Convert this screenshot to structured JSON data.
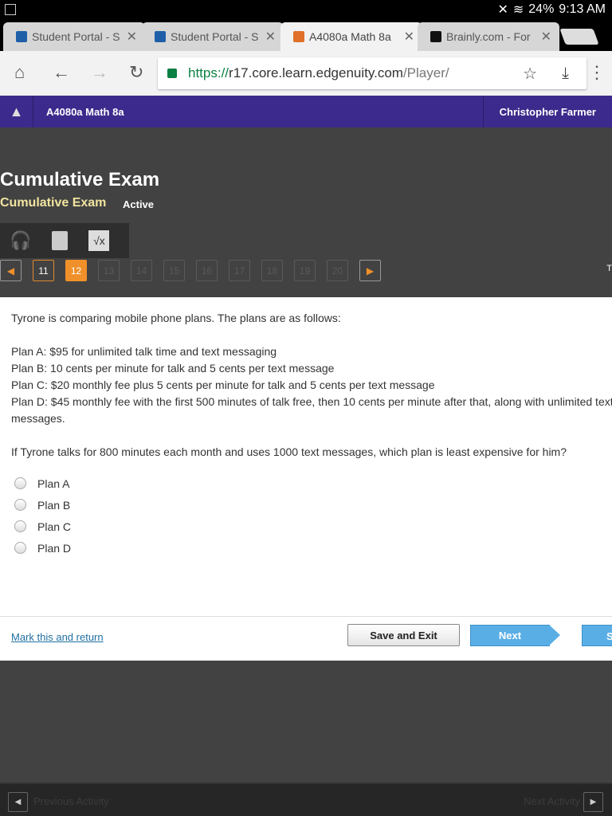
{
  "status": {
    "battery": "24%",
    "time": "9:13 AM"
  },
  "tabs": [
    {
      "title": "Student Portal - S",
      "active": false
    },
    {
      "title": "Student Portal - S",
      "active": false
    },
    {
      "title": "A4080a Math 8a",
      "active": true
    },
    {
      "title": "Brainly.com - For",
      "active": false
    }
  ],
  "url": {
    "scheme": "https://",
    "host": "r17.core.learn.edgenuity.com",
    "path": "/Player/"
  },
  "app": {
    "course": "A4080a Math 8a",
    "user": "Christopher Farmer"
  },
  "exam": {
    "title": "Cumulative Exam",
    "subtitle": "Cumulative Exam",
    "status": "Active"
  },
  "pager": {
    "pages": [
      "11",
      "12",
      "13",
      "14",
      "15",
      "16",
      "17",
      "18",
      "19",
      "20"
    ],
    "current": "12",
    "visited": [
      "11"
    ],
    "right_char": "T"
  },
  "question": {
    "text": "Tyrone is comparing mobile phone plans. The plans are as follows:\n\nPlan A: $95 for unlimited talk time and text messaging\nPlan B: 10 cents per minute for talk and 5 cents per text message\nPlan C: $20 monthly fee plus 5 cents per minute for talk and 5 cents per text message\nPlan D: $45 monthly fee with the first 500 minutes of talk free, then 10 cents per minute after that, along with unlimited text\nmessages.\n\nIf Tyrone talks for 800 minutes each month and uses 1000 text messages, which plan is least expensive for him?",
    "options": [
      "Plan A",
      "Plan B",
      "Plan C",
      "Plan D"
    ]
  },
  "footer": {
    "mark": "Mark this and return",
    "save": "Save and Exit",
    "next": "Next",
    "submit": "S"
  },
  "bottom": {
    "prev": "Previous Activity",
    "next": "Next Activity"
  },
  "colors": {
    "appbar": "#3c2a8c",
    "accent": "#f0902a",
    "next": "#5aaee6"
  }
}
